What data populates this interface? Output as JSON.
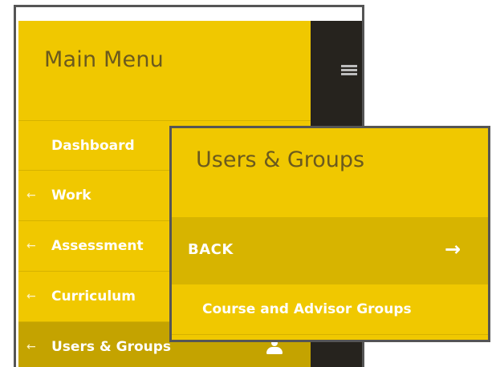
{
  "main_menu": {
    "title": "Main Menu",
    "items": [
      {
        "label": "Dashboard",
        "arrow": ""
      },
      {
        "label": "Work",
        "arrow": "←"
      },
      {
        "label": "Assessment",
        "arrow": "←"
      },
      {
        "label": "Curriculum",
        "arrow": "←"
      },
      {
        "label": "Users & Groups",
        "arrow": "←"
      }
    ]
  },
  "submenu": {
    "title": "Users & Groups",
    "back_label": "BACK",
    "back_arrow": "→",
    "items": [
      {
        "label": "Course and Advisor Groups"
      }
    ]
  },
  "icons": {
    "menu": "hamburger-menu-icon",
    "users": "users-icon"
  },
  "colors": {
    "brand_yellow": "#f0c800",
    "back_row": "#d7b400",
    "active_item": "#c4a300",
    "dark_strip": "#26231e",
    "title_text": "#6b5a1e"
  }
}
